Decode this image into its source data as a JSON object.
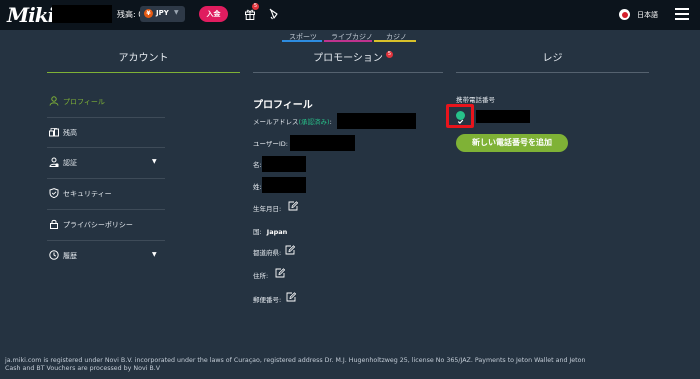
{
  "header": {
    "logo": "Miki",
    "balance_label": "残高: 0",
    "currency_coin": "¥",
    "currency": "JPY",
    "deposit_label": "入金",
    "gift_badge": "5",
    "language": "日本語"
  },
  "top_tabs": [
    {
      "label": "スポーツ",
      "color": "#2d8ce0"
    },
    {
      "label": "ライブカジノ",
      "color": "#c0338e"
    },
    {
      "label": "カジノ",
      "color": "#d8c12a"
    }
  ],
  "main_tabs": [
    {
      "label": "アカウント",
      "active": true
    },
    {
      "label": "プロモーション",
      "badge": "5"
    },
    {
      "label": "レジ"
    }
  ],
  "sidebar": {
    "items": [
      {
        "label": "プロフィール",
        "icon": "user-icon",
        "active": true
      },
      {
        "label": "残高",
        "icon": "balance-icon"
      },
      {
        "label": "認証",
        "icon": "verification-icon",
        "has_submenu": true
      },
      {
        "label": "セキュリティー",
        "icon": "shield-icon"
      },
      {
        "label": "プライバシーポリシー",
        "icon": "lock-icon"
      },
      {
        "label": "履歴",
        "icon": "history-icon",
        "has_submenu": true
      }
    ]
  },
  "profile": {
    "title": "プロフィール",
    "email_label": "メールアドレス",
    "email_status": "(承認済み)",
    "email_colon": ":",
    "user_id_label": "ユーザーID:",
    "first_name_label": "名:",
    "last_name_label": "姓:",
    "birthdate_label": "生年月日:",
    "country_label": "国:",
    "country_value": "Japan",
    "prefecture_label": "都道府県:",
    "address_label": "住所:",
    "postal_label": "郵便番号:"
  },
  "phone": {
    "label": "携帯電話番号",
    "add_button": "新しい電話番号を追加"
  },
  "footer": {
    "line1": "ja.miki.com is registered under Novi B.V. incorporated under the laws of Curaçao, registered address Dr. M.J. Hugenholtzweg 25, license No 365/JAZ. Payments to Jeton Wallet and Jeton",
    "line2": "Cash and BT Vouchers are processed by Novi B.V"
  },
  "colors": {
    "background": "#253341",
    "topbar": "#0c141c",
    "accent_green": "#7fb236",
    "deposit_pink": "#e01d5f",
    "verified_green": "#27c28a",
    "highlight_red": "#e8141c"
  }
}
